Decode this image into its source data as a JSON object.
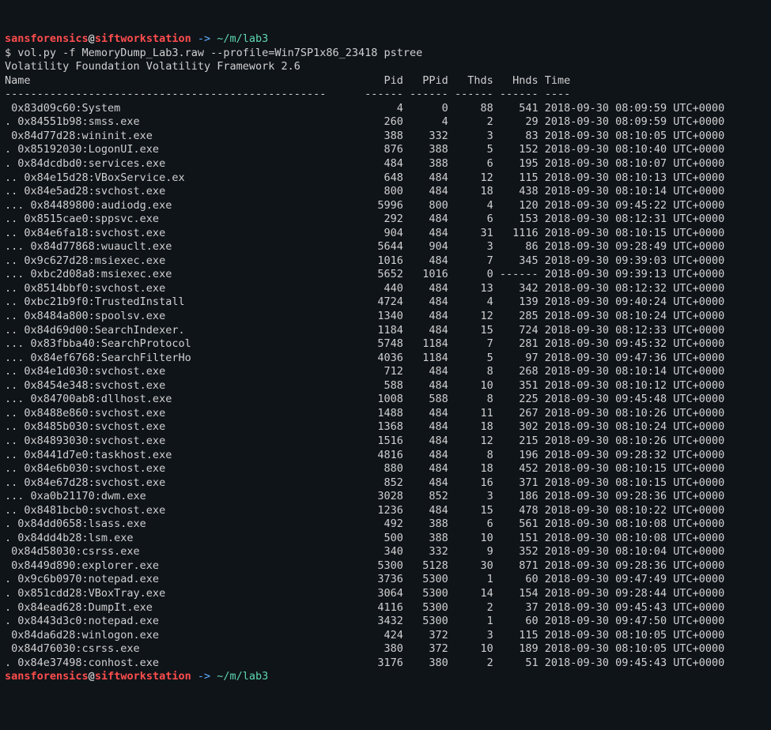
{
  "prompt1": {
    "user": "sansforensics",
    "at": "@",
    "host": "siftworkstation",
    "arrow": " -> ",
    "path": "~/m/lab3"
  },
  "command": "$ vol.py -f MemoryDump_Lab3.raw --profile=Win7SP1x86_23418 pstree",
  "framework_line": "Volatility Foundation Volatility Framework 2.6",
  "header": {
    "name": "Name",
    "pid": "Pid",
    "ppid": "PPid",
    "thds": "Thds",
    "hnds": "Hnds",
    "time": "Time"
  },
  "rows": [
    {
      "name": " 0x83d09c60:System",
      "pid": "4",
      "ppid": "0",
      "thds": "88",
      "hnds": "541",
      "time": "2018-09-30 08:09:59 UTC+0000"
    },
    {
      "name": ". 0x84551b98:smss.exe",
      "pid": "260",
      "ppid": "4",
      "thds": "2",
      "hnds": "29",
      "time": "2018-09-30 08:09:59 UTC+0000"
    },
    {
      "name": " 0x84d77d28:wininit.exe",
      "pid": "388",
      "ppid": "332",
      "thds": "3",
      "hnds": "83",
      "time": "2018-09-30 08:10:05 UTC+0000"
    },
    {
      "name": ". 0x85192030:LogonUI.exe",
      "pid": "876",
      "ppid": "388",
      "thds": "5",
      "hnds": "152",
      "time": "2018-09-30 08:10:40 UTC+0000"
    },
    {
      "name": ". 0x84dcdbd0:services.exe",
      "pid": "484",
      "ppid": "388",
      "thds": "6",
      "hnds": "195",
      "time": "2018-09-30 08:10:07 UTC+0000"
    },
    {
      "name": ".. 0x84e15d28:VBoxService.ex",
      "pid": "648",
      "ppid": "484",
      "thds": "12",
      "hnds": "115",
      "time": "2018-09-30 08:10:13 UTC+0000"
    },
    {
      "name": ".. 0x84e5ad28:svchost.exe",
      "pid": "800",
      "ppid": "484",
      "thds": "18",
      "hnds": "438",
      "time": "2018-09-30 08:10:14 UTC+0000"
    },
    {
      "name": "... 0x84489800:audiodg.exe",
      "pid": "5996",
      "ppid": "800",
      "thds": "4",
      "hnds": "120",
      "time": "2018-09-30 09:45:22 UTC+0000"
    },
    {
      "name": ".. 0x8515cae0:sppsvc.exe",
      "pid": "292",
      "ppid": "484",
      "thds": "6",
      "hnds": "153",
      "time": "2018-09-30 08:12:31 UTC+0000"
    },
    {
      "name": ".. 0x84e6fa18:svchost.exe",
      "pid": "904",
      "ppid": "484",
      "thds": "31",
      "hnds": "1116",
      "time": "2018-09-30 08:10:15 UTC+0000"
    },
    {
      "name": "... 0x84d77868:wuauclt.exe",
      "pid": "5644",
      "ppid": "904",
      "thds": "3",
      "hnds": "86",
      "time": "2018-09-30 09:28:49 UTC+0000"
    },
    {
      "name": ".. 0x9c627d28:msiexec.exe",
      "pid": "1016",
      "ppid": "484",
      "thds": "7",
      "hnds": "345",
      "time": "2018-09-30 09:39:03 UTC+0000"
    },
    {
      "name": "... 0xbc2d08a8:msiexec.exe",
      "pid": "5652",
      "ppid": "1016",
      "thds": "0",
      "hnds": "------",
      "time": "2018-09-30 09:39:13 UTC+0000"
    },
    {
      "name": ".. 0x8514bbf0:svchost.exe",
      "pid": "440",
      "ppid": "484",
      "thds": "13",
      "hnds": "342",
      "time": "2018-09-30 08:12:32 UTC+0000"
    },
    {
      "name": ".. 0xbc21b9f0:TrustedInstall",
      "pid": "4724",
      "ppid": "484",
      "thds": "4",
      "hnds": "139",
      "time": "2018-09-30 09:40:24 UTC+0000"
    },
    {
      "name": ".. 0x8484a800:spoolsv.exe",
      "pid": "1340",
      "ppid": "484",
      "thds": "12",
      "hnds": "285",
      "time": "2018-09-30 08:10:24 UTC+0000"
    },
    {
      "name": ".. 0x84d69d00:SearchIndexer.",
      "pid": "1184",
      "ppid": "484",
      "thds": "15",
      "hnds": "724",
      "time": "2018-09-30 08:12:33 UTC+0000"
    },
    {
      "name": "... 0x83fbba40:SearchProtocol",
      "pid": "5748",
      "ppid": "1184",
      "thds": "7",
      "hnds": "281",
      "time": "2018-09-30 09:45:32 UTC+0000"
    },
    {
      "name": "... 0x84ef6768:SearchFilterHo",
      "pid": "4036",
      "ppid": "1184",
      "thds": "5",
      "hnds": "97",
      "time": "2018-09-30 09:47:36 UTC+0000"
    },
    {
      "name": ".. 0x84e1d030:svchost.exe",
      "pid": "712",
      "ppid": "484",
      "thds": "8",
      "hnds": "268",
      "time": "2018-09-30 08:10:14 UTC+0000"
    },
    {
      "name": ".. 0x8454e348:svchost.exe",
      "pid": "588",
      "ppid": "484",
      "thds": "10",
      "hnds": "351",
      "time": "2018-09-30 08:10:12 UTC+0000"
    },
    {
      "name": "... 0x84700ab8:dllhost.exe",
      "pid": "1008",
      "ppid": "588",
      "thds": "8",
      "hnds": "225",
      "time": "2018-09-30 09:45:48 UTC+0000"
    },
    {
      "name": ".. 0x8488e860:svchost.exe",
      "pid": "1488",
      "ppid": "484",
      "thds": "11",
      "hnds": "267",
      "time": "2018-09-30 08:10:26 UTC+0000"
    },
    {
      "name": ".. 0x8485b030:svchost.exe",
      "pid": "1368",
      "ppid": "484",
      "thds": "18",
      "hnds": "302",
      "time": "2018-09-30 08:10:24 UTC+0000"
    },
    {
      "name": ".. 0x84893030:svchost.exe",
      "pid": "1516",
      "ppid": "484",
      "thds": "12",
      "hnds": "215",
      "time": "2018-09-30 08:10:26 UTC+0000"
    },
    {
      "name": ".. 0x8441d7e0:taskhost.exe",
      "pid": "4816",
      "ppid": "484",
      "thds": "8",
      "hnds": "196",
      "time": "2018-09-30 09:28:32 UTC+0000"
    },
    {
      "name": ".. 0x84e6b030:svchost.exe",
      "pid": "880",
      "ppid": "484",
      "thds": "18",
      "hnds": "452",
      "time": "2018-09-30 08:10:15 UTC+0000"
    },
    {
      "name": ".. 0x84e67d28:svchost.exe",
      "pid": "852",
      "ppid": "484",
      "thds": "16",
      "hnds": "371",
      "time": "2018-09-30 08:10:15 UTC+0000"
    },
    {
      "name": "... 0xa0b21170:dwm.exe",
      "pid": "3028",
      "ppid": "852",
      "thds": "3",
      "hnds": "186",
      "time": "2018-09-30 09:28:36 UTC+0000"
    },
    {
      "name": ".. 0x8481bcb0:svchost.exe",
      "pid": "1236",
      "ppid": "484",
      "thds": "15",
      "hnds": "478",
      "time": "2018-09-30 08:10:22 UTC+0000"
    },
    {
      "name": ". 0x84dd0658:lsass.exe",
      "pid": "492",
      "ppid": "388",
      "thds": "6",
      "hnds": "561",
      "time": "2018-09-30 08:10:08 UTC+0000"
    },
    {
      "name": ". 0x84dd4b28:lsm.exe",
      "pid": "500",
      "ppid": "388",
      "thds": "10",
      "hnds": "151",
      "time": "2018-09-30 08:10:08 UTC+0000"
    },
    {
      "name": " 0x84d58030:csrss.exe",
      "pid": "340",
      "ppid": "332",
      "thds": "9",
      "hnds": "352",
      "time": "2018-09-30 08:10:04 UTC+0000"
    },
    {
      "name": " 0x8449d890:explorer.exe",
      "pid": "5300",
      "ppid": "5128",
      "thds": "30",
      "hnds": "871",
      "time": "2018-09-30 09:28:36 UTC+0000"
    },
    {
      "name": ". 0x9c6b0970:notepad.exe",
      "pid": "3736",
      "ppid": "5300",
      "thds": "1",
      "hnds": "60",
      "time": "2018-09-30 09:47:49 UTC+0000"
    },
    {
      "name": ". 0x851cdd28:VBoxTray.exe",
      "pid": "3064",
      "ppid": "5300",
      "thds": "14",
      "hnds": "154",
      "time": "2018-09-30 09:28:44 UTC+0000"
    },
    {
      "name": ". 0x84ead628:DumpIt.exe",
      "pid": "4116",
      "ppid": "5300",
      "thds": "2",
      "hnds": "37",
      "time": "2018-09-30 09:45:43 UTC+0000"
    },
    {
      "name": ". 0x8443d3c0:notepad.exe",
      "pid": "3432",
      "ppid": "5300",
      "thds": "1",
      "hnds": "60",
      "time": "2018-09-30 09:47:50 UTC+0000"
    },
    {
      "name": " 0x84da6d28:winlogon.exe",
      "pid": "424",
      "ppid": "372",
      "thds": "3",
      "hnds": "115",
      "time": "2018-09-30 08:10:05 UTC+0000"
    },
    {
      "name": " 0x84d76030:csrss.exe",
      "pid": "380",
      "ppid": "372",
      "thds": "10",
      "hnds": "189",
      "time": "2018-09-30 08:10:05 UTC+0000"
    },
    {
      "name": ". 0x84e37498:conhost.exe",
      "pid": "3176",
      "ppid": "380",
      "thds": "2",
      "hnds": "51",
      "time": "2018-09-30 09:45:43 UTC+0000"
    }
  ],
  "prompt2": {
    "user": "sansforensics",
    "at": "@",
    "host": "siftworkstation",
    "arrow": " -> ",
    "path": "~/m/lab3"
  }
}
